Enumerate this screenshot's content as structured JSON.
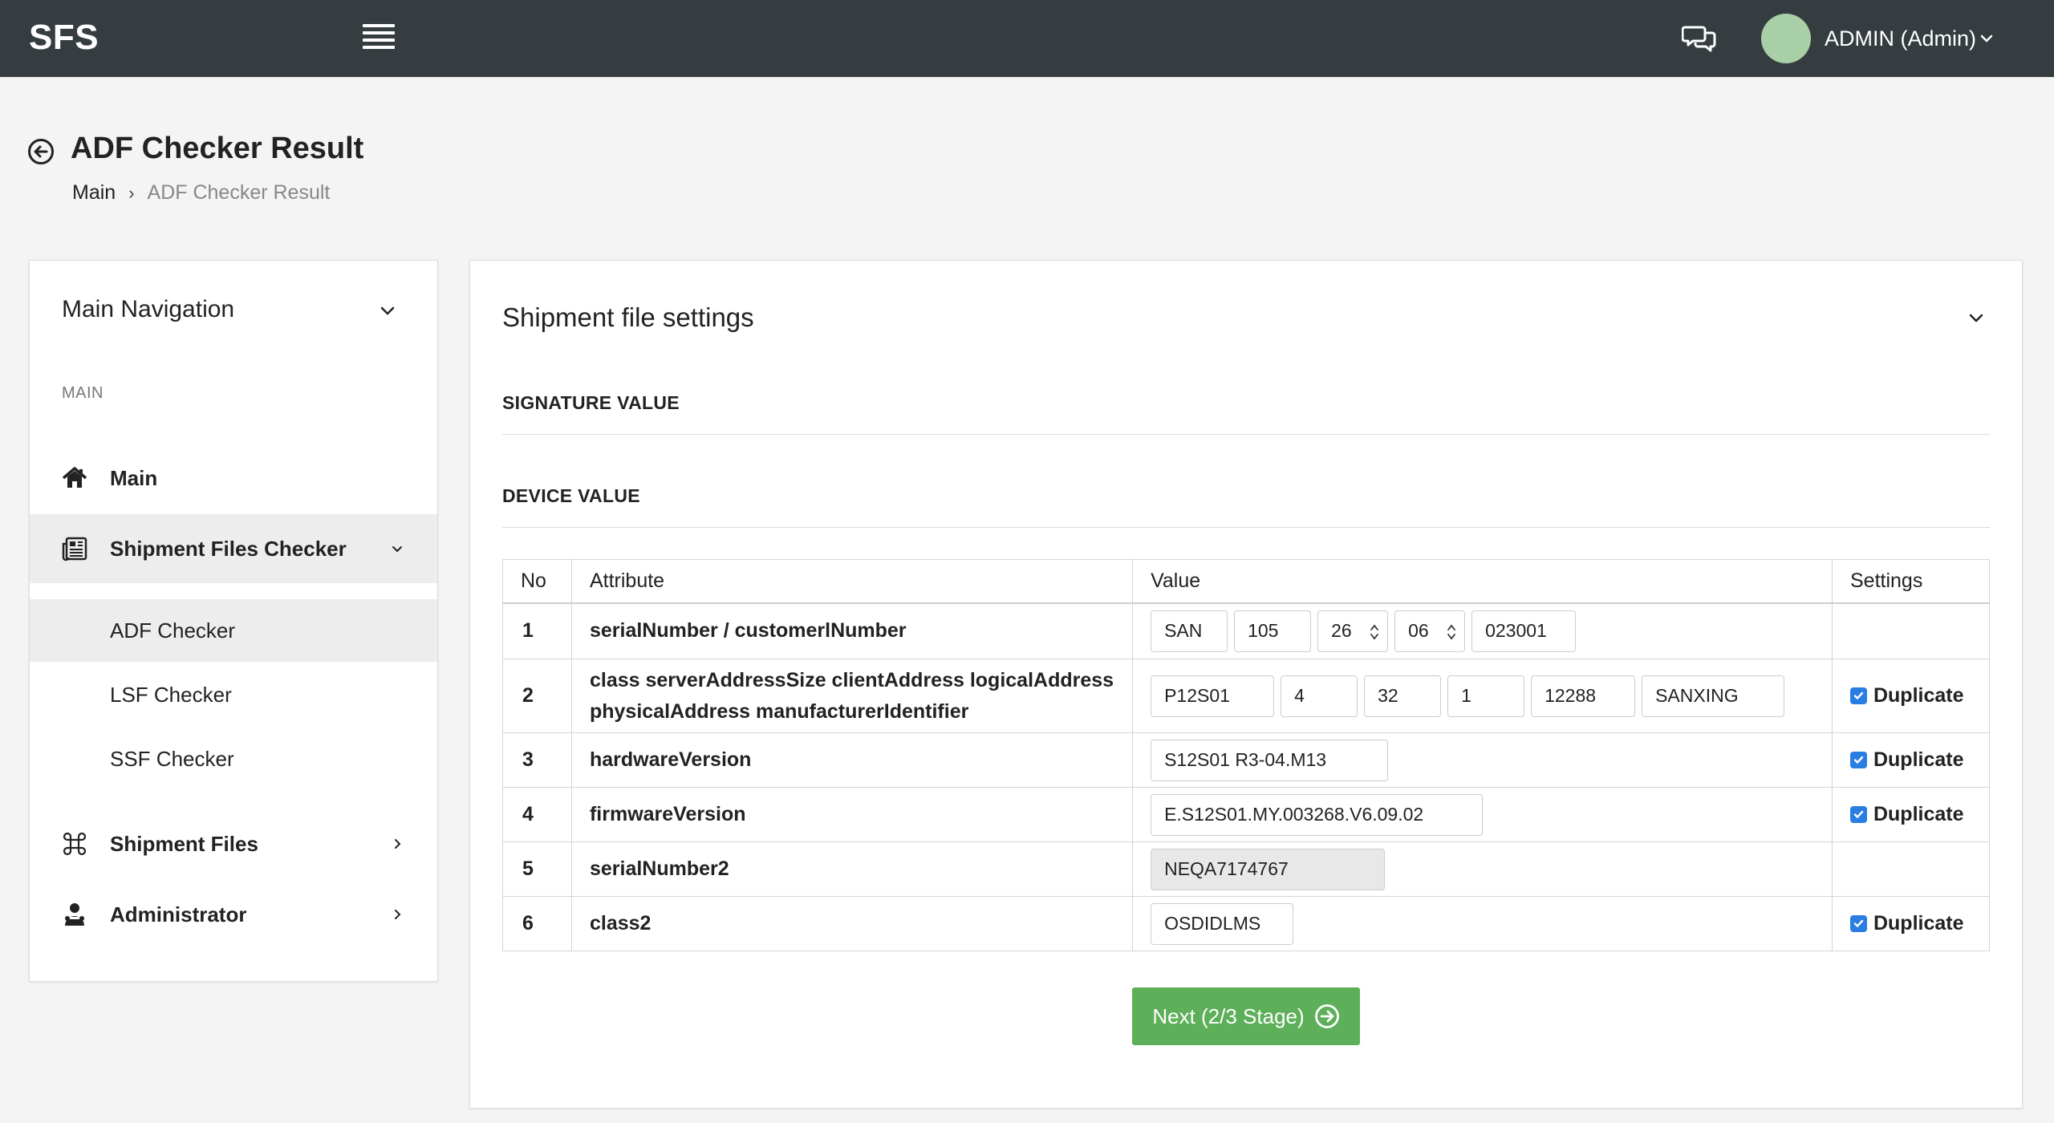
{
  "topbar": {
    "brand": "SFS",
    "user_label": "ADMIN (Admin)",
    "icons": {
      "menu": "hamburger-menu-icon",
      "chat": "chat-bubbles-icon",
      "caret": "chevron-down-icon"
    },
    "colors": {
      "background": "#353d41",
      "avatar": "#a8cfa6"
    }
  },
  "page": {
    "title": "ADF Checker Result",
    "breadcrumb": {
      "main": "Main",
      "separator": "›",
      "current": "ADF Checker Result"
    }
  },
  "sidebar": {
    "header": "Main Navigation",
    "section_label": "MAIN",
    "items": {
      "main": {
        "label": "Main",
        "icon": "home-icon"
      },
      "shipment_files_checker": {
        "label": "Shipment Files Checker",
        "icon": "newspaper-icon",
        "expanded": true,
        "children": [
          "ADF Checker",
          "LSF Checker",
          "SSF Checker"
        ],
        "active_child": "ADF Checker"
      },
      "shipment_files": {
        "label": "Shipment Files",
        "icon": "command-icon"
      },
      "administrator": {
        "label": "Administrator",
        "icon": "user-admin-icon"
      }
    }
  },
  "card": {
    "title": "Shipment file settings",
    "signature_heading": "SIGNATURE VALUE",
    "device_heading": "DEVICE VALUE",
    "table": {
      "headers": {
        "no": "No",
        "attribute": "Attribute",
        "value": "Value",
        "settings": "Settings"
      },
      "rows": [
        {
          "no": "1",
          "attribute": "serialNumber / customerlNumber",
          "values": [
            "SAN",
            "105",
            "26",
            "06",
            "023001"
          ],
          "duplicate": null
        },
        {
          "no": "2",
          "attribute_line1": "class serverAddressSize clientAddress logicalAddress",
          "attribute_line2": "physicalAddress manufacturerIdentifier",
          "values": [
            "P12S01",
            "4",
            "32",
            "1",
            "12288",
            "SANXING"
          ],
          "duplicate": "Duplicate"
        },
        {
          "no": "3",
          "attribute": "hardwareVersion",
          "values": [
            "S12S01 R3-04.M13"
          ],
          "duplicate": "Duplicate"
        },
        {
          "no": "4",
          "attribute": "firmwareVersion",
          "values": [
            "E.S12S01.MY.003268.V6.09.02"
          ],
          "duplicate": "Duplicate"
        },
        {
          "no": "5",
          "attribute": "serialNumber2",
          "values": [
            "NEQA7174767"
          ],
          "disabled": true,
          "duplicate": null
        },
        {
          "no": "6",
          "attribute": "class2",
          "values": [
            "OSDIDLMS"
          ],
          "duplicate": "Duplicate"
        }
      ]
    },
    "next_button": "Next (2/3 Stage)",
    "colors": {
      "button": "#5daf5a",
      "checkbox": "#2a7de1"
    }
  }
}
